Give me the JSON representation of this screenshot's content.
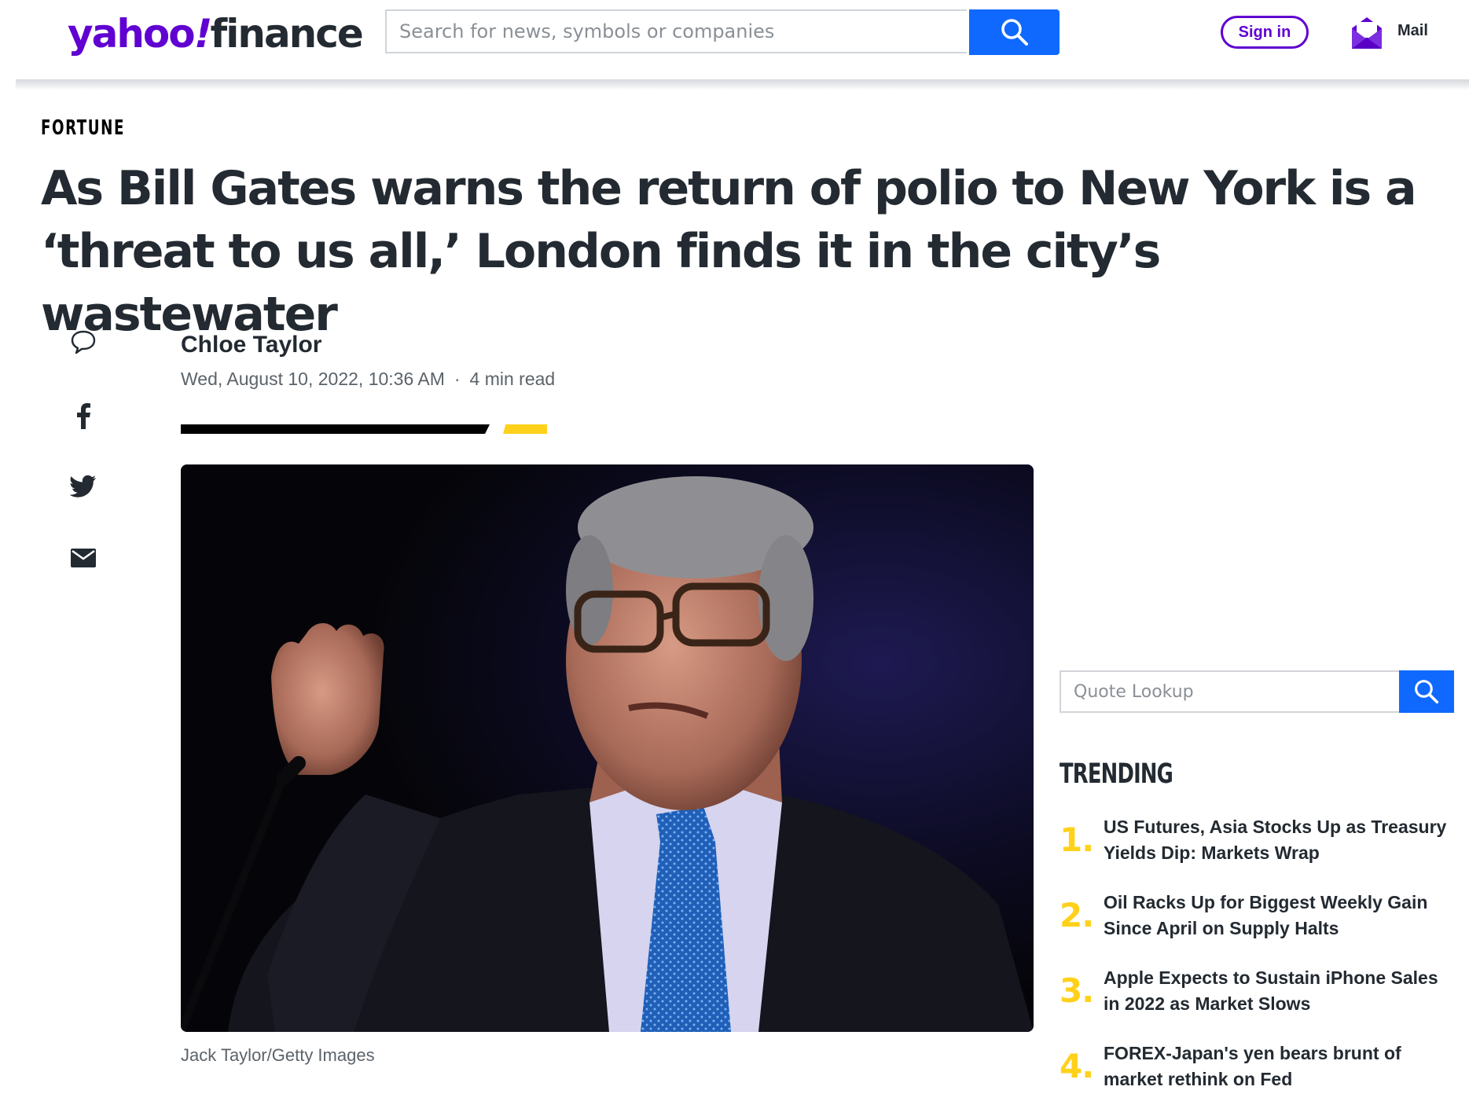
{
  "header": {
    "logo": {
      "yahoo": "yahoo",
      "bang": "!",
      "finance": "finance",
      "brand_color": "#6001d2"
    },
    "search": {
      "placeholder": "Search for news, symbols or companies",
      "icon": "search-icon",
      "button_color": "#0f69ff"
    },
    "sign_in_label": "Sign in",
    "mail": {
      "icon": "mail-envelope-icon",
      "label": "Mail"
    }
  },
  "article": {
    "publisher": "FORTUNE",
    "headline": "As Bill Gates warns the return of polio to New York is a ‘threat to us all,’ London finds it in the city’s wastewater",
    "author": "Chloe Taylor",
    "date": "Wed, August 10, 2022, 10:36 AM",
    "separator": "·",
    "read_time": "4 min read",
    "share_icons": [
      "comment-icon",
      "facebook-icon",
      "twitter-icon",
      "email-icon"
    ],
    "image": {
      "subject": "photo-bill-gates",
      "caption": "Jack Taylor/Getty Images"
    }
  },
  "sidebar": {
    "quote_lookup": {
      "placeholder": "Quote Lookup",
      "icon": "search-icon"
    },
    "trending": {
      "title": "TRENDING",
      "accent_color": "#ffd11a",
      "items": [
        {
          "num": "1.",
          "text": "US Futures, Asia Stocks Up as Treasury Yields Dip: Markets Wrap"
        },
        {
          "num": "2.",
          "text": "Oil Racks Up for Biggest Weekly Gain Since April on Supply Halts"
        },
        {
          "num": "3.",
          "text": "Apple Expects to Sustain iPhone Sales in 2022 as Market Slows"
        },
        {
          "num": "4.",
          "text": "FOREX-Japan's yen bears brunt of market rethink on Fed"
        }
      ]
    }
  }
}
